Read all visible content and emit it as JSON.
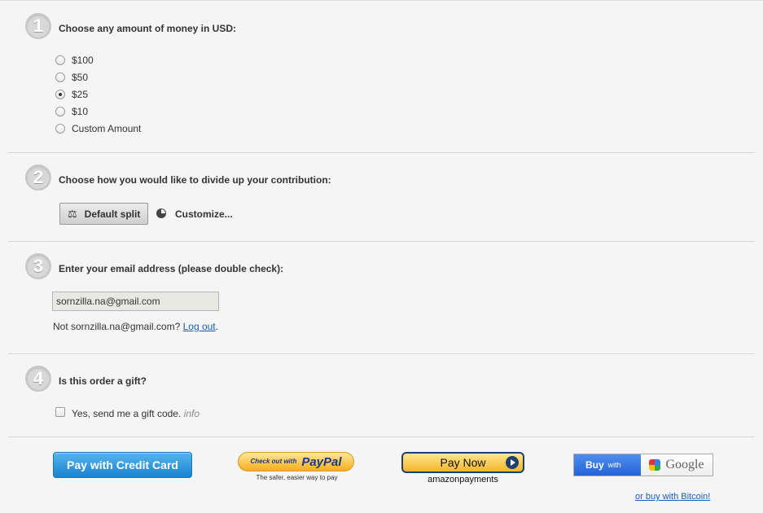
{
  "steps": [
    {
      "number": "1",
      "title": "Choose any amount of money in USD:"
    },
    {
      "number": "2",
      "title": "Choose how you would like to divide up your contribution:"
    },
    {
      "number": "3",
      "title": "Enter your email address (please double check):"
    },
    {
      "number": "4",
      "title": "Is this order a gift?"
    }
  ],
  "amount_options": [
    {
      "label": "$100",
      "checked": false
    },
    {
      "label": "$50",
      "checked": false
    },
    {
      "label": "$25",
      "checked": true
    },
    {
      "label": "$10",
      "checked": false
    },
    {
      "label": "Custom Amount",
      "checked": false
    }
  ],
  "split": {
    "default_label": "Default split",
    "customize_label": "Customize..."
  },
  "email": {
    "value": "sornzilla.na@gmail.com",
    "not_prefix": "Not sornzilla.na@gmail.com?",
    "logout_label": "Log out",
    "logout_suffix": "."
  },
  "gift": {
    "label": "Yes, send me a gift code.",
    "info": "info"
  },
  "payment": {
    "credit_card_label": "Pay with Credit Card",
    "paypal_small": "Check out with",
    "paypal_brand": "PayPal",
    "paypal_tagline": "The safer, easier way to pay",
    "amazon_label": "Pay Now",
    "amazon_logo": "amazonpayments",
    "google_buy": "Buy",
    "google_with": "with",
    "google_brand": "Google",
    "bitcoin_label": "or buy with Bitcoin!"
  }
}
